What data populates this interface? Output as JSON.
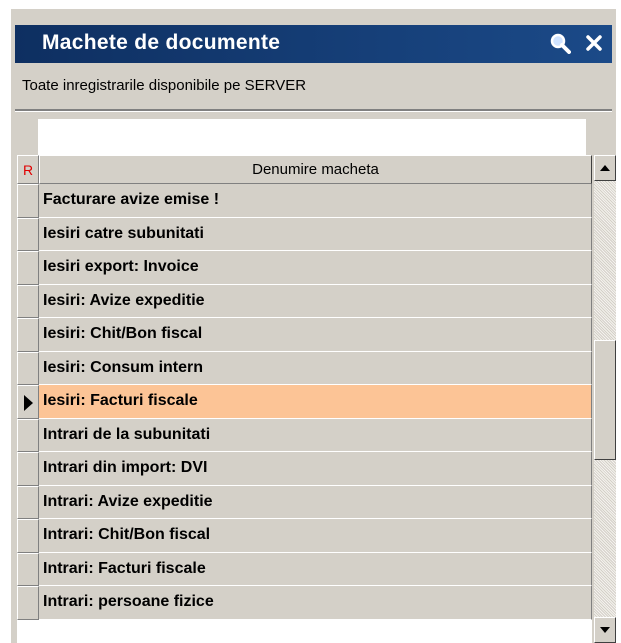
{
  "window": {
    "title": "Machete de documente"
  },
  "toolbar": {
    "search_icon": "magnifier-icon",
    "close_icon": "close-icon"
  },
  "subtitle": "Toate inregistrarile disponibile pe SERVER",
  "filter": {
    "value": ""
  },
  "grid": {
    "indicator_header": "R",
    "column_header": "Denumire macheta",
    "rows": [
      "Facturare avize emise !",
      "Iesiri catre subunitati",
      "Iesiri export: Invoice",
      "Iesiri: Avize expeditie",
      "Iesiri: Chit/Bon fiscal",
      "Iesiri: Consum intern",
      "Iesiri: Facturi fiscale",
      "Intrari de la subunitati",
      "Intrari din import: DVI",
      "Intrari: Avize expeditie",
      "Intrari: Chit/Bon fiscal",
      "Intrari: Facturi fiscale",
      "Intrari: persoane fizice"
    ],
    "selected_index": 6,
    "selected_color": "#fcc496"
  }
}
